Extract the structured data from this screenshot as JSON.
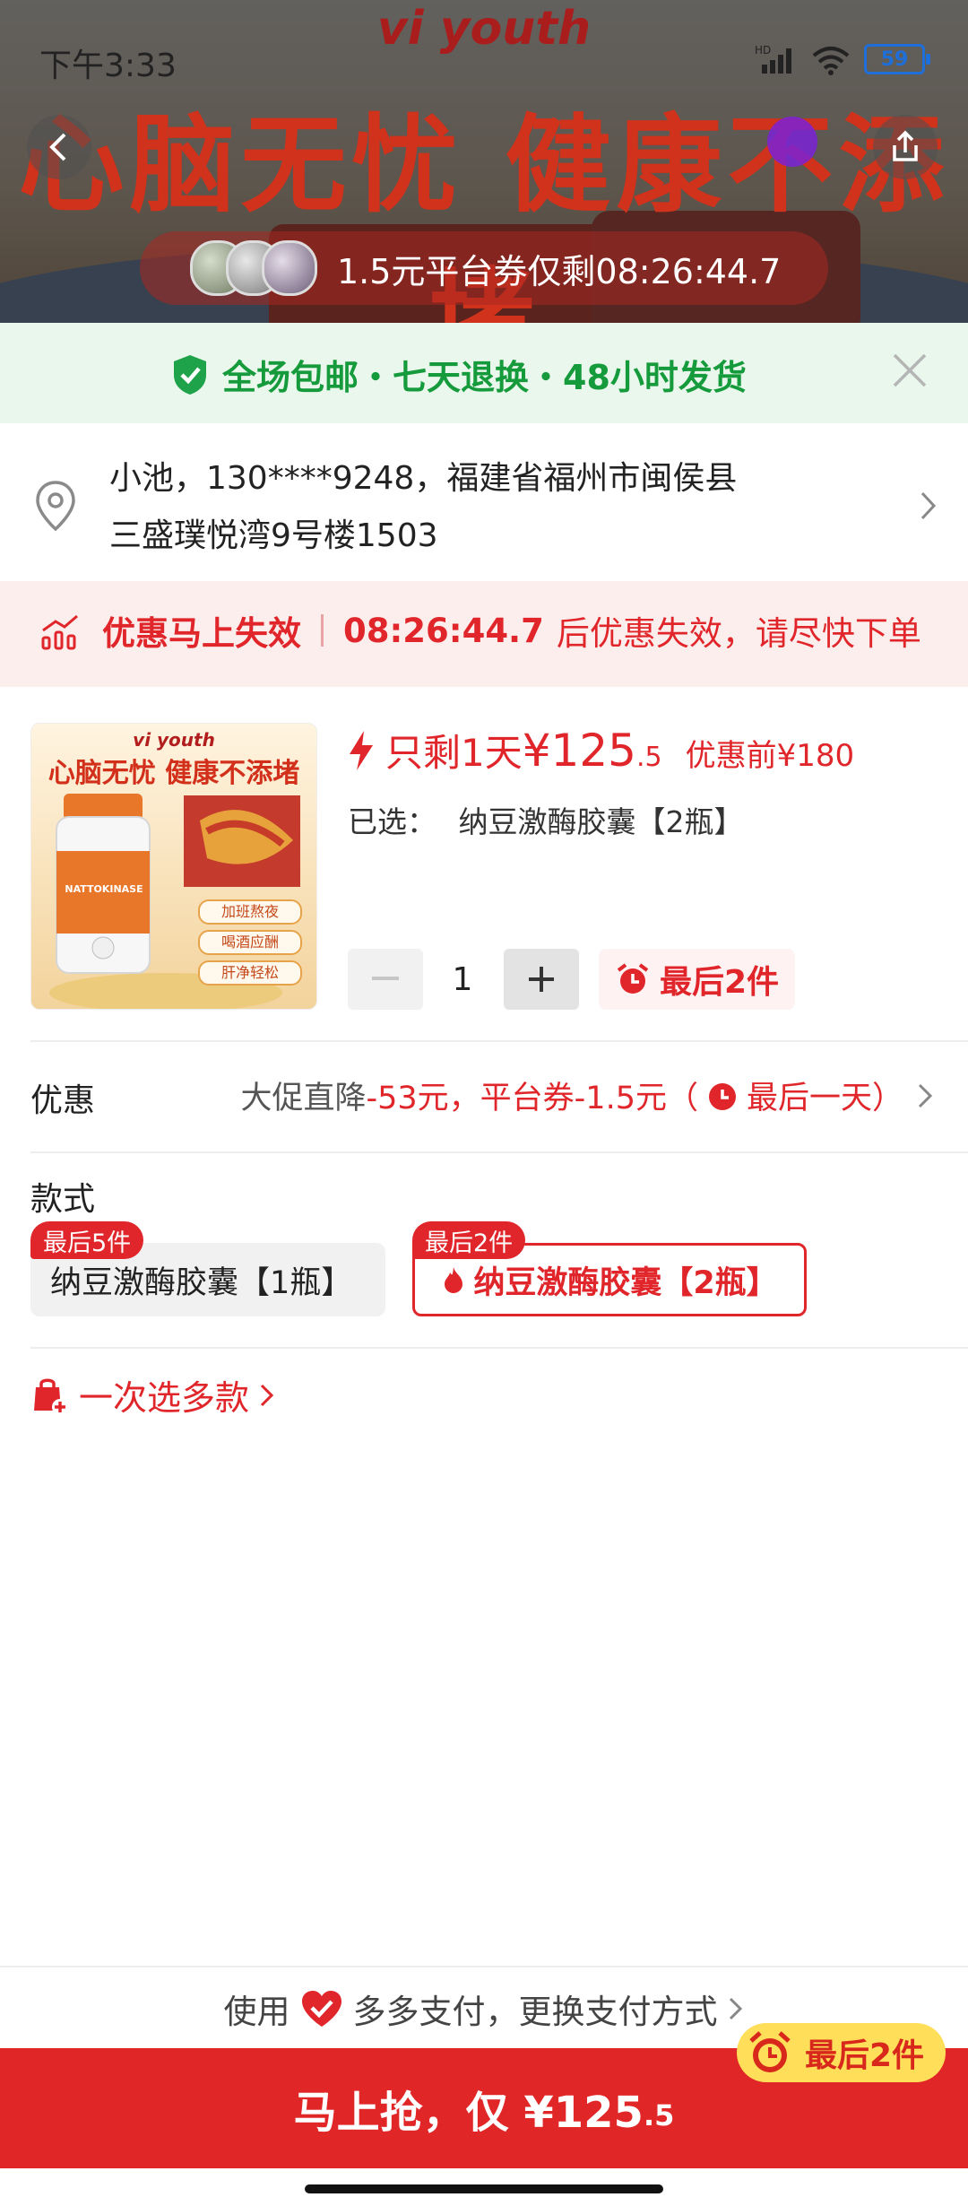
{
  "status_bar": {
    "time": "下午3:33",
    "battery": "59"
  },
  "banner": {
    "brand_logo": "vi youth",
    "slogan": "心脑无忧 健康不添堵",
    "coupon_text": "1.5元平台券仅剩08:26:44.7"
  },
  "benefits": {
    "text": "全场包邮・七天退换・48小时发货"
  },
  "address": {
    "line1": "小池，130****9248，福建省福州市闽侯县",
    "line2": "三盛璞悦湾9号楼1503"
  },
  "countdown": {
    "title": "优惠马上失效",
    "timer": "08:26:44.7",
    "suffix": "后优惠失效，请尽快下单"
  },
  "product": {
    "image_brand": "vi youth",
    "image_slogan": "心脑无忧 健康不添堵",
    "image_label": "NATTOKINASE",
    "image_tags": [
      "加班熬夜",
      "喝酒应酬",
      "肝净轻松"
    ],
    "price_prefix": "只剩1天",
    "price_currency": "¥",
    "price_int": "125",
    "price_dec": ".5",
    "price_before": "优惠前¥180",
    "selected_label": "已选：",
    "selected_value": "纳豆激酶胶囊【2瓶】",
    "quantity": "1",
    "last_stock": "最后2件"
  },
  "promo": {
    "label": "优惠",
    "part1": "大促直降",
    "part2": "-53元，平台券-1.5元（",
    "part3": "最后一天）"
  },
  "style": {
    "label": "款式",
    "options": [
      {
        "name": "纳豆激酶胶囊【1瓶】",
        "tag": "最后5件",
        "selected": false
      },
      {
        "name": "纳豆激酶胶囊【2瓶】",
        "tag": "最后2件",
        "selected": true
      }
    ]
  },
  "multi_select": {
    "label": "一次选多款"
  },
  "payment": {
    "prefix": "使用",
    "method": "多多支付，更换支付方式"
  },
  "buy": {
    "label": "马上抢，仅 ¥125",
    "label_dec": ".5",
    "badge": "最后2件"
  },
  "colors": {
    "accent_red": "#e0262a",
    "benefit_green": "#159a3c",
    "badge_yellow": "#ffde5a"
  }
}
